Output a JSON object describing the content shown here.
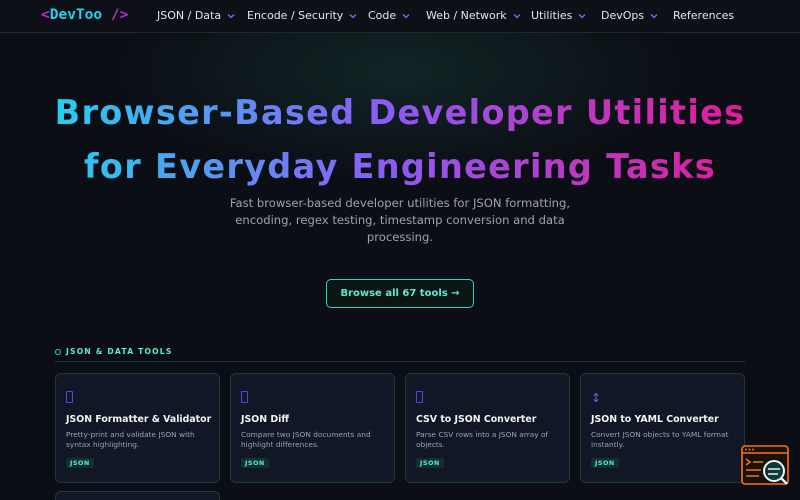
{
  "brand": {
    "open": "<",
    "name": "DevToo",
    "close": " />"
  },
  "nav": {
    "items": [
      {
        "label": "JSON / Data",
        "has_menu": true
      },
      {
        "label": "Encode / Security",
        "has_menu": true
      },
      {
        "label": "Code",
        "has_menu": true
      },
      {
        "label": "Web / Network",
        "has_menu": true
      },
      {
        "label": "Utilities",
        "has_menu": true
      },
      {
        "label": "DevOps",
        "has_menu": true
      },
      {
        "label": "References",
        "has_menu": false
      }
    ]
  },
  "hero": {
    "title_line1": "Browser-Based Developer Utilities",
    "title_line2": "for Everyday Engineering Tasks",
    "subtitle": "Fast browser-based developer utilities for JSON formatting, encoding, regex testing, timestamp conversion and data processing.",
    "cta_label": "Browse all 67 tools →"
  },
  "section": {
    "label": "JSON & DATA TOOLS",
    "cards": [
      {
        "icon": "box-icon",
        "title": "JSON Formatter & Validator",
        "description": "Pretty-print and validate JSON with syntax highlighting.",
        "tag": "JSON"
      },
      {
        "icon": "box-icon",
        "title": "JSON Diff",
        "description": "Compare two JSON documents and highlight differences.",
        "tag": "JSON"
      },
      {
        "icon": "box-icon",
        "title": "CSV to JSON Converter",
        "description": "Parse CSV rows into a JSON array of objects.",
        "tag": "JSON"
      },
      {
        "icon": "arrows-vertical-icon",
        "glyph": "↕",
        "title": "JSON to YAML Converter",
        "description": "Convert JSON objects to YAML format instantly.",
        "tag": "JSON"
      }
    ]
  },
  "colors": {
    "accent_teal": "#2dd4bf",
    "accent_cyan": "#22d3ee",
    "accent_violet": "#8b5cf6",
    "accent_magenta": "#e11d9b",
    "background": "#0b0e14",
    "fab_orange": "#f97316"
  }
}
